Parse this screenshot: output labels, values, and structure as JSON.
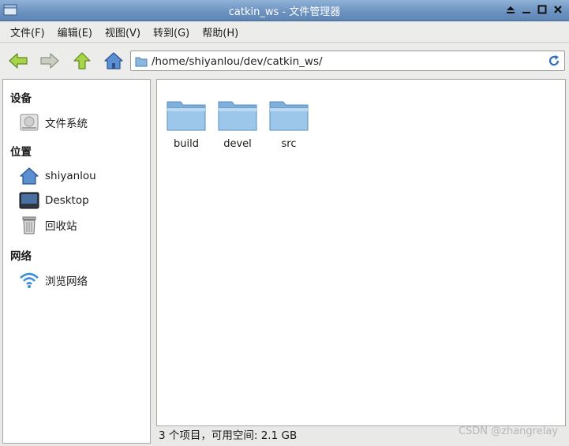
{
  "window": {
    "title": "catkin_ws - 文件管理器"
  },
  "menubar": {
    "items": [
      "文件(F)",
      "编辑(E)",
      "视图(V)",
      "转到(G)",
      "帮助(H)"
    ]
  },
  "toolbar": {
    "address": "/home/shiyanlou/dev/catkin_ws/"
  },
  "sidebar": {
    "sections": [
      {
        "title": "设备",
        "items": [
          {
            "label": "文件系统",
            "icon": "drive-icon"
          }
        ]
      },
      {
        "title": "位置",
        "items": [
          {
            "label": "shiyanlou",
            "icon": "home-icon"
          },
          {
            "label": "Desktop",
            "icon": "desktop-icon"
          },
          {
            "label": "回收站",
            "icon": "trash-icon"
          }
        ]
      },
      {
        "title": "网络",
        "items": [
          {
            "label": "浏览网络",
            "icon": "network-icon"
          }
        ]
      }
    ]
  },
  "files": [
    {
      "name": "build",
      "icon": "folder-icon"
    },
    {
      "name": "devel",
      "icon": "folder-icon"
    },
    {
      "name": "src",
      "icon": "folder-icon"
    }
  ],
  "status": {
    "text": "3 个项目，可用空间: 2.1 GB"
  },
  "watermark": "CSDN @zhangrelay",
  "colors": {
    "titlebar": "#6d93c0",
    "folder": "#7fb0dc",
    "arrow_green": "#9ccc3a"
  }
}
